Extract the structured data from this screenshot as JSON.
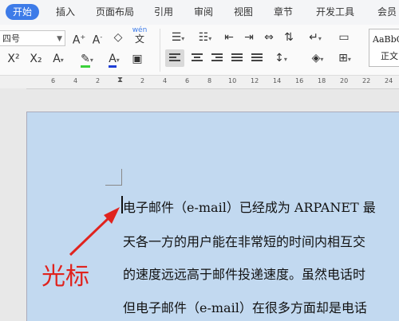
{
  "menu": {
    "tabs": [
      {
        "label": "开始",
        "active": true
      },
      {
        "label": "插入"
      },
      {
        "label": "页面布局"
      },
      {
        "label": "引用"
      },
      {
        "label": "审阅"
      },
      {
        "label": "视图"
      },
      {
        "label": "章节"
      },
      {
        "label": "开发工具"
      },
      {
        "label": "会员"
      }
    ]
  },
  "ribbon": {
    "font_size": "四号",
    "wen_label": "wén",
    "wen_char": "文",
    "style_preview": "AaBbC",
    "style_name": "正文"
  },
  "ruler": {
    "numbers": [
      "6",
      "4",
      "2",
      "2",
      "4",
      "6",
      "8",
      "10",
      "12",
      "14",
      "16",
      "18",
      "20",
      "22",
      "24"
    ]
  },
  "document": {
    "lines": [
      "电子邮件（e-mail）已经成为 ARPANET 最",
      "天各一方的用户能在非常短的时间内相互交",
      "的速度远远高于邮件投递速度。虽然电话时",
      "但电子邮件（e-mail）在很多方面却是电话"
    ]
  },
  "annotation": {
    "label": "光标",
    "color": "#e0231e"
  },
  "colors": {
    "accent": "#3d7be8",
    "page": "#c2d9f0"
  }
}
